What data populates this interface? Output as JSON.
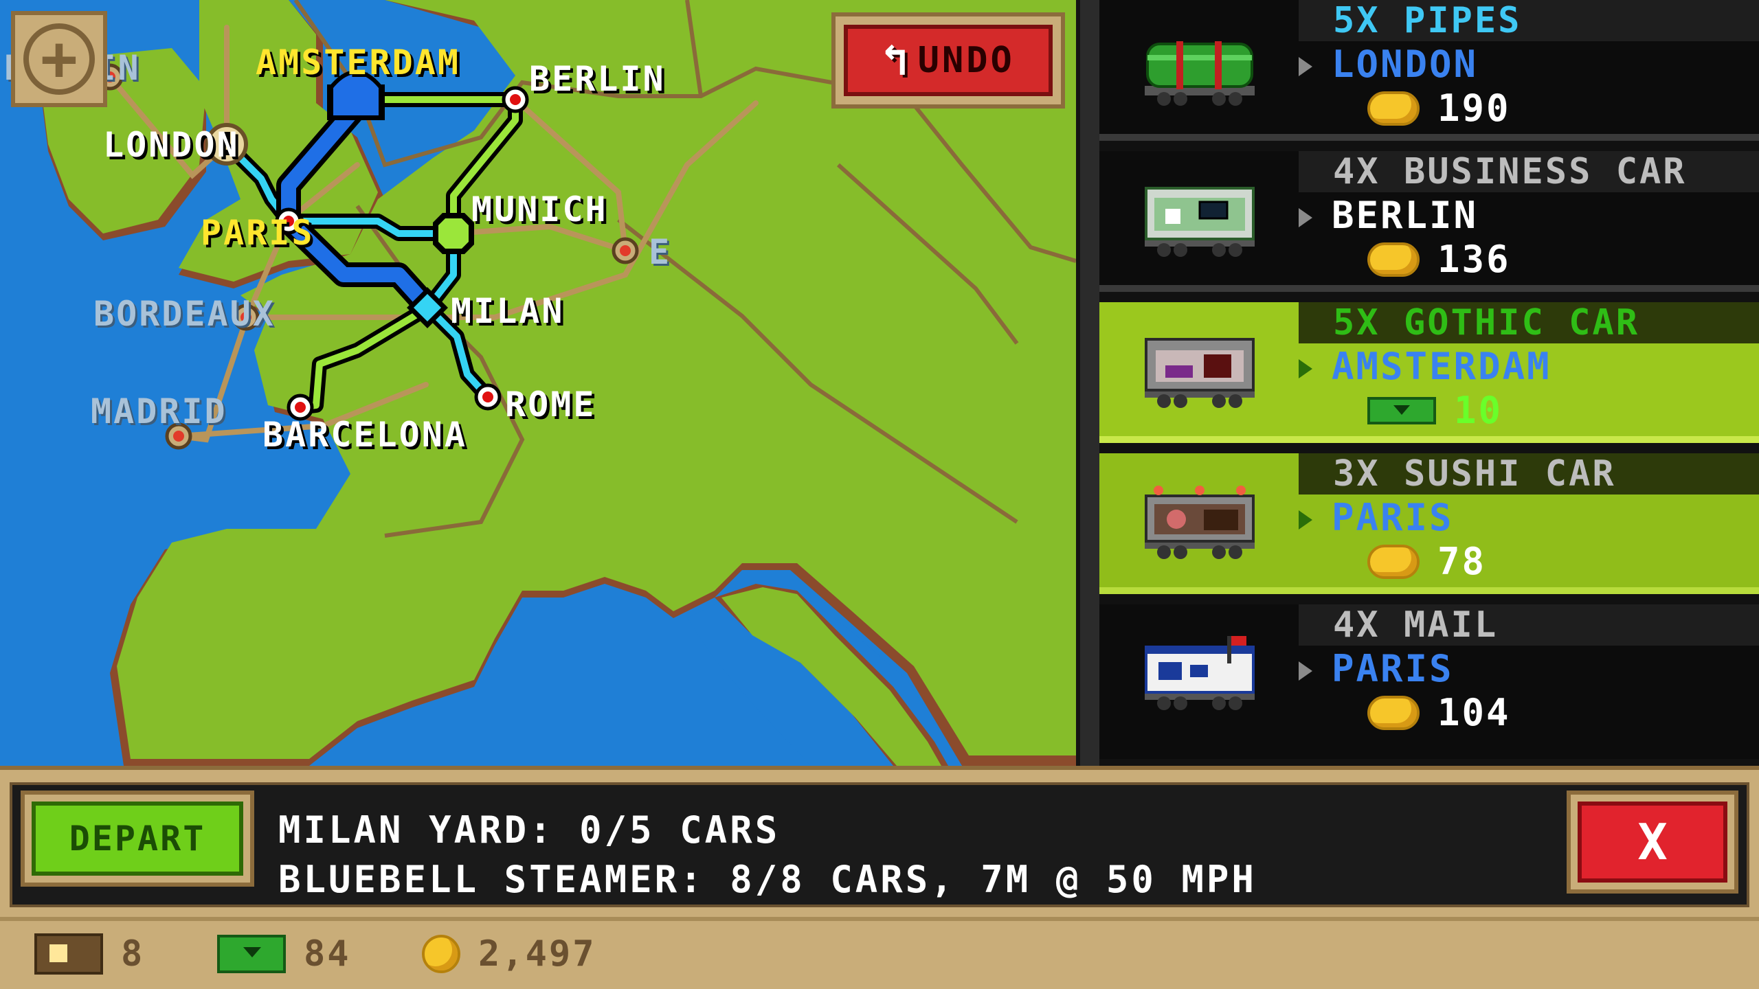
{
  "map": {
    "cities": [
      {
        "id": "dublin",
        "name": "DUBLIN",
        "label_style": "faded"
      },
      {
        "id": "amsterdam",
        "name": "AMSTERDAM",
        "label_style": "yellow"
      },
      {
        "id": "berlin",
        "name": "BERLIN",
        "label_style": "white"
      },
      {
        "id": "london",
        "name": "LONDON",
        "label_style": "white"
      },
      {
        "id": "paris",
        "name": "PARIS",
        "label_style": "yellow"
      },
      {
        "id": "munich",
        "name": "MUNICH",
        "label_style": "white"
      },
      {
        "id": "bordeaux",
        "name": "BORDEAUX",
        "label_style": "faded"
      },
      {
        "id": "milan",
        "name": "MILAN",
        "label_style": "white"
      },
      {
        "id": "madrid",
        "name": "MADRID",
        "label_style": "faded"
      },
      {
        "id": "barcelona",
        "name": "BARCELONA",
        "label_style": "white"
      },
      {
        "id": "rome",
        "name": "ROME",
        "label_style": "white"
      },
      {
        "id": "e_partial",
        "name": "E",
        "label_style": "faded"
      }
    ],
    "undo_label": "UNDO",
    "zoom_icon": "zoom-in-icon"
  },
  "cargo_list": [
    {
      "quantity": "5X",
      "cargo": "PIPES",
      "destination": "LONDON",
      "reward_type": "coins",
      "reward": "190",
      "icon": "pipes-car-icon",
      "state": "normal",
      "qty_color": "cyan",
      "dest_color": "blue"
    },
    {
      "quantity": "4X",
      "cargo": "BUSINESS CAR",
      "destination": "BERLIN",
      "reward_type": "coins",
      "reward": "136",
      "icon": "business-car-icon",
      "state": "normal",
      "qty_color": "grey",
      "dest_color": "white"
    },
    {
      "quantity": "5X",
      "cargo": "GOTHIC CAR",
      "destination": "AMSTERDAM",
      "reward_type": "cash",
      "reward": "10",
      "icon": "gothic-car-icon",
      "state": "selected",
      "qty_color": "green",
      "dest_color": "blue"
    },
    {
      "quantity": "3X",
      "cargo": "SUSHI CAR",
      "destination": "PARIS",
      "reward_type": "coins",
      "reward": "78",
      "icon": "sushi-car-icon",
      "state": "highlight",
      "qty_color": "grey",
      "dest_color": "blue"
    },
    {
      "quantity": "4X",
      "cargo": "MAIL",
      "destination": "PARIS",
      "reward_type": "coins",
      "reward": "104",
      "icon": "mail-car-icon",
      "state": "normal",
      "qty_color": "grey",
      "dest_color": "blue"
    }
  ],
  "bottom_panel": {
    "depart_label": "DEPART",
    "yard_status": "MILAN YARD: 0/5 CARS",
    "train_status": "BLUEBELL STEAMER: 8/8 CARS, 7M @ 50 MPH",
    "close_label": "X"
  },
  "resources": {
    "tickets": "8",
    "cash": "84",
    "coins": "2,497"
  },
  "colors": {
    "route_blue": "#1f6fe6",
    "route_cyan": "#35d4f4",
    "route_green": "#9be63a",
    "sea": "#1f7fd6",
    "land": "#86bd2a",
    "panel_tan": "#c9ad79",
    "button_green": "#6fcf1a",
    "button_red": "#e1232d"
  }
}
